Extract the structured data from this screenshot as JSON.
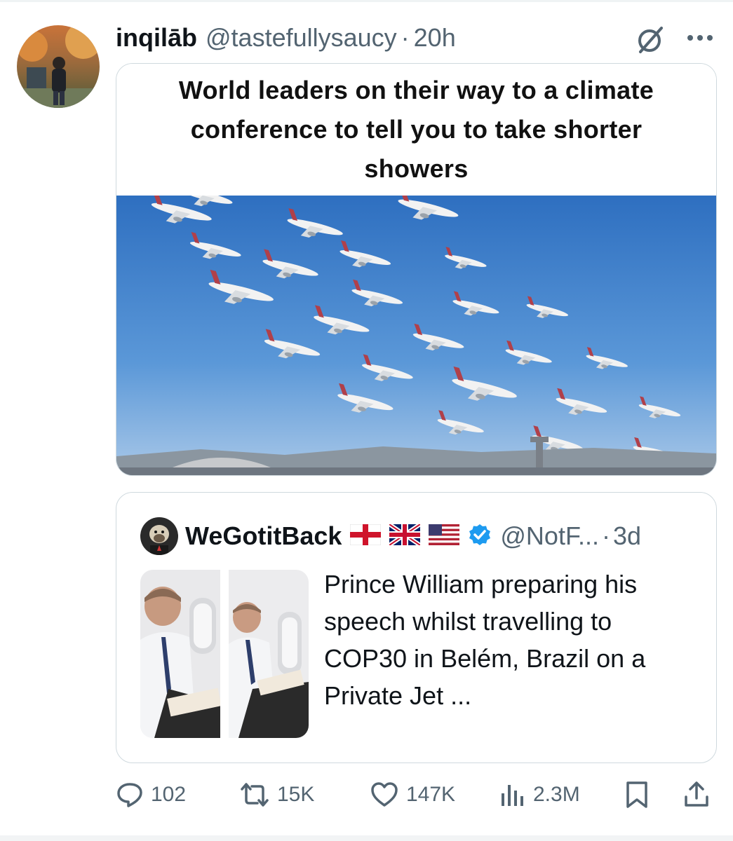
{
  "post": {
    "display_name": "inqilāb",
    "handle": "@tastefullysaucy",
    "separator": "·",
    "time": "20h",
    "media_caption": "World leaders on their way to a climate conference to tell you to take shorter showers"
  },
  "quoted": {
    "display_name": "WeGotitBack",
    "flags": [
      "england-flag",
      "uk-flag",
      "us-flag"
    ],
    "verified": true,
    "handle": "@NotF...",
    "separator": "·",
    "time": "3d",
    "text": "Prince William preparing his speech whilst travelling to COP30 in Belém, Brazil on a Private Jet ..."
  },
  "actions": {
    "replies": "102",
    "reposts": "15K",
    "likes": "147K",
    "views": "2.3M"
  },
  "icons": [
    "grok-icon",
    "more-icon",
    "reply-icon",
    "repost-icon",
    "like-icon",
    "views-icon",
    "bookmark-icon",
    "share-icon",
    "verified-icon"
  ],
  "colors": {
    "text": "#0f1419",
    "secondary": "#536471",
    "border": "#cfd9de",
    "verified": "#1d9bf0"
  }
}
